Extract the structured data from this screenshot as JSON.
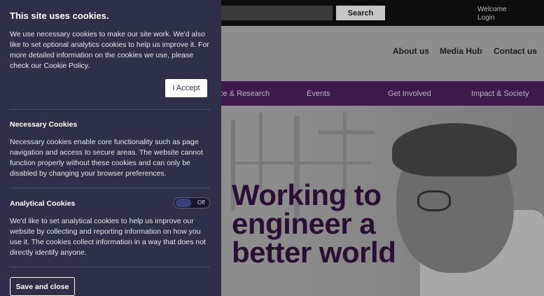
{
  "site": {
    "search_label": "Search",
    "welcome": "Welcome",
    "login": "Login",
    "main_nav": [
      "About us",
      "Media Hub",
      "Contact us"
    ],
    "sub_nav": [
      "ce & Research",
      "Events",
      "Get Involved",
      "Impact & Society"
    ],
    "hero_title_lines": [
      "Working to",
      "engineer a",
      "better world"
    ]
  },
  "cookie_panel": {
    "title": "This site uses cookies.",
    "intro": "We use necessary cookies to make our site work. We'd also like to set optional analytics cookies to help us improve it. For more detailed information on the cookies we use, please check our Cookie Policy.",
    "accept_label": "I Accept",
    "necessary": {
      "heading": "Necessary Cookies",
      "text": "Necessary cookies enable core functionality such as page navigation and access to secure areas. The website cannot function properly without these cookies and can only be disabled by changing your browser preferences."
    },
    "analytical": {
      "heading": "Analytical Cookies",
      "toggle_state": "Off",
      "text": "We'd like to set analytical cookies to help us improve our website by collecting and reporting information on how you use it. The cookies collect information in a way that does not directly identify anyone."
    },
    "save_label": "Save and close"
  },
  "colors": {
    "panel_bg": "#2d3048",
    "nav_purple": "#3d1a4a",
    "hero_title": "#2a0f35"
  }
}
